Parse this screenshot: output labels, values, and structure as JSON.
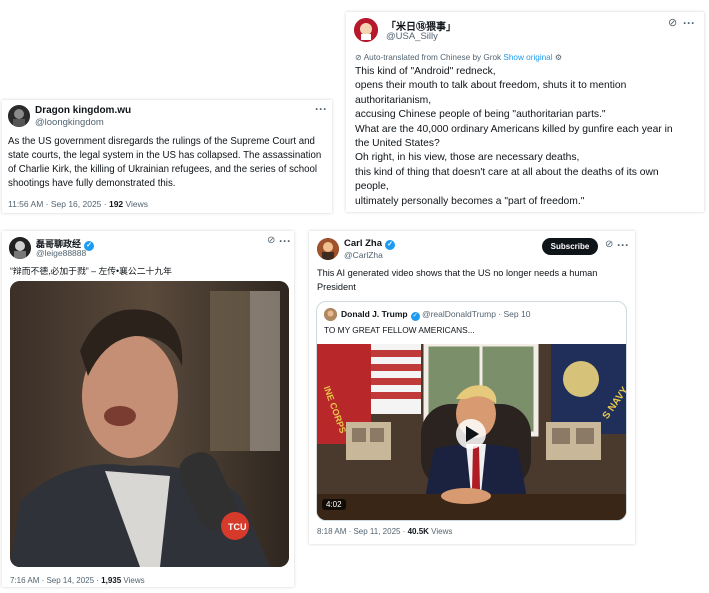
{
  "tweet_top_right": {
    "name": "「米日⑱猥事」",
    "handle": "@USA_Silly",
    "translate_note": "Auto-translated from Chinese by Grok",
    "show_original": "Show original",
    "lines": [
      "This kind of \"Android\" redneck,",
      "opens their mouth to talk about freedom, shuts it to mention",
      "authoritarianism,",
      "accusing Chinese people of being \"authoritarian parts.\"",
      "What are the 40,000 ordinary Americans killed by gunfire each year in",
      "the United States?",
      "Oh right, in his view, those are necessary deaths,",
      "this kind of thing that doesn't care at all about the deaths of its own",
      "people,",
      "ultimately personally becomes a \"part of freedom.\""
    ],
    "more": "···"
  },
  "tweet_dragon": {
    "name": "Dragon kingdom.wu",
    "handle": "@loongkingdom",
    "lines": [
      "As the US government disregards the rulings of the Supreme Court and",
      "state courts, the legal system in the US has collapsed. The assassination",
      "of Charlie Kirk, the killing of Ukrainian refugees, and the series of school",
      "shootings have fully demonstrated this."
    ],
    "time": "11:56 AM · Sep 16, 2025 · ",
    "views_count": "192",
    "views_label": " Views",
    "more": "···"
  },
  "tweet_leige": {
    "name": "磊哥聊政经",
    "handle": "@leige88888",
    "text": "“辩而不德,必加于戮” – 左传•襄公二十九年",
    "time": "7:16 AM · Sep 14, 2025 · ",
    "views_count": "1,935",
    "views_label": " Views",
    "more": "···"
  },
  "tweet_carl": {
    "name": "Carl Zha",
    "handle": "@CarlZha",
    "subscribe": "Subscribe",
    "lines": [
      "This AI generated video shows that the US no longer needs a human",
      "President"
    ],
    "quoted": {
      "name": "Donald J. Trump",
      "handle": "@realDonaldTrump · Sep 10",
      "text": "TO MY GREAT FELLOW AMERICANS..."
    },
    "video_duration": "4:02",
    "video_flag_text": "INE CORPS",
    "navy_text": "S NAVY",
    "time": "8:18 AM · Sep 11, 2025 · ",
    "views_count": "40.5K",
    "views_label": " Views",
    "more": "···"
  },
  "colors": {
    "link": "#1d9bf0",
    "secondary": "#536471",
    "text": "#0f1419",
    "subscribe_bg": "#0f1419"
  }
}
